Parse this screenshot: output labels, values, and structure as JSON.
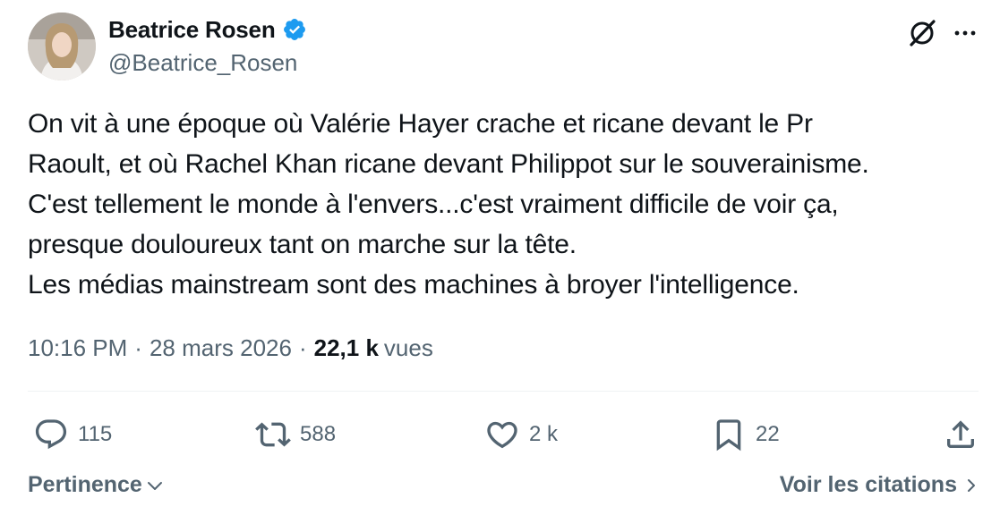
{
  "author": {
    "display_name": "Beatrice Rosen",
    "handle": "@Beatrice_Rosen",
    "verified_color": "#1d9bf0"
  },
  "top_actions": {
    "grok_icon": "grok-icon",
    "more_icon": "more-icon"
  },
  "tweet": {
    "lines": [
      "On vit à une époque où Valérie Hayer crache et ricane devant le Pr",
      "Raoult, et où Rachel Khan ricane devant Philippot sur le souverainisme.",
      "C'est tellement le monde à l'envers...c'est vraiment difficile de voir ça,",
      "presque douloureux tant on marche sur la tête.",
      "Les médias mainstream sont des machines à broyer l'intelligence."
    ]
  },
  "meta": {
    "time": "10:16 PM",
    "separator": "·",
    "date": "28 mars 2026",
    "views_count": "22,1 k",
    "views_label": "vues"
  },
  "actions": {
    "reply_count": "115",
    "repost_count": "588",
    "like_count": "2 k",
    "bookmark_count": "22"
  },
  "footer": {
    "sort_label": "Pertinence",
    "quotes_label": "Voir les citations"
  },
  "colors": {
    "text_primary": "#0f1419",
    "text_secondary": "#536471",
    "divider": "#eff3f4",
    "accent": "#1d9bf0"
  }
}
